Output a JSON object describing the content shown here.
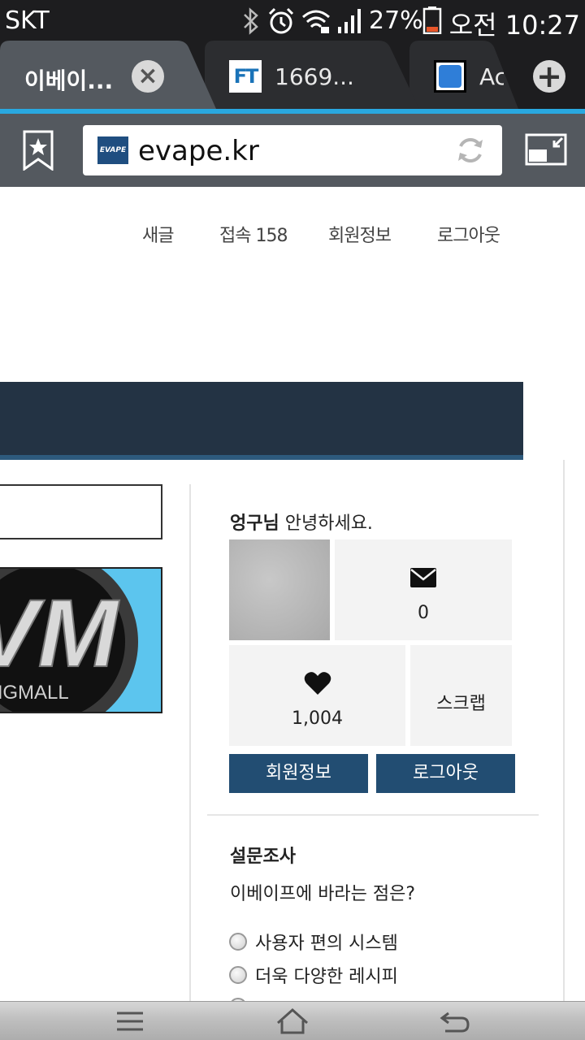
{
  "status_bar": {
    "carrier": "SKT",
    "battery_percent": "27%",
    "time": "오전 10:27",
    "battery_level": 0.27
  },
  "tabs": [
    {
      "title": "이베이...",
      "active": true
    },
    {
      "title": "1669...",
      "favicon_text": "FT"
    },
    {
      "title": "Ac"
    }
  ],
  "address_bar": {
    "url": "evape.kr",
    "site_favicon_text": "EVAPE"
  },
  "top_nav": {
    "new_posts": "새글",
    "visitors": "접속 158",
    "member_info": "회원정보",
    "logout": "로그아웃"
  },
  "logo_image": {
    "text_large": "VM",
    "text_small": "NGMALL"
  },
  "member_panel": {
    "username": "엉구님",
    "greeting": "안녕하세요.",
    "messages_count": "0",
    "likes_count": "1,004",
    "scrap_label": "스크랩",
    "member_info_button": "회원정보",
    "logout_button": "로그아웃"
  },
  "poll": {
    "title": "설문조사",
    "question": "이베이프에 바라는 점은?",
    "options": [
      "사용자 편의 시스템",
      "더욱 다양한 레시피"
    ]
  },
  "colors": {
    "accent": "#29a8e0",
    "banner": "#233344",
    "button": "#224d72"
  }
}
